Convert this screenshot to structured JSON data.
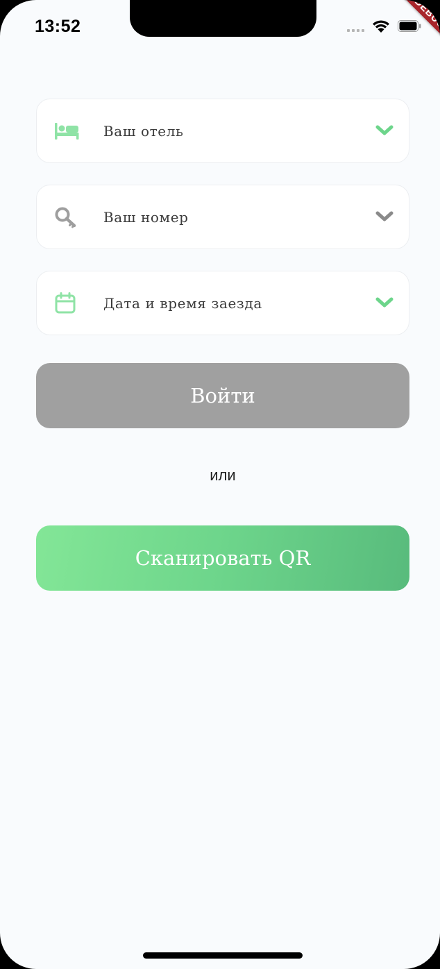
{
  "status_bar": {
    "time": "13:52",
    "debug_banner": "DEBUG"
  },
  "form": {
    "fields": [
      {
        "label": "Ваш отель",
        "icon": "bed-icon",
        "icon_color": "#8fe3a6",
        "chevron_color": "#6dd58b"
      },
      {
        "label": "Ваш номер",
        "icon": "key-icon",
        "icon_color": "#9e9e9e",
        "chevron_color": "#8a8a8a"
      },
      {
        "label": "Дата и время заезда",
        "icon": "calendar-icon",
        "icon_color": "#8fe3a6",
        "chevron_color": "#6dd58b"
      }
    ],
    "login_label": "Войти",
    "or_label": "или",
    "scan_label": "Сканировать QR"
  },
  "colors": {
    "background": "#f9fbfd",
    "accent_green": "#6dd58b",
    "disabled_gray": "#a0a0a0"
  }
}
